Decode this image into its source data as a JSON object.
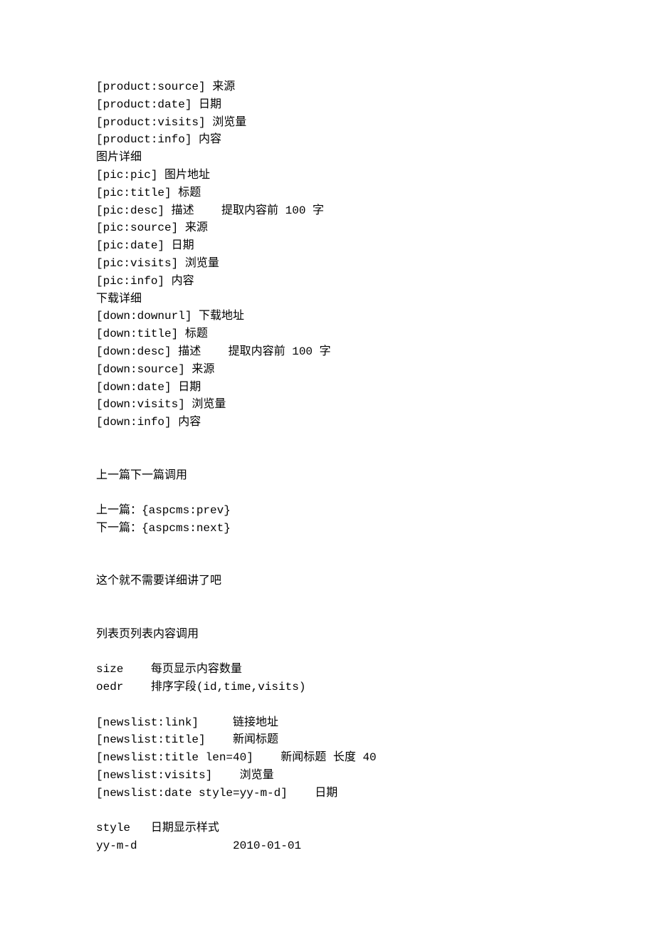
{
  "lines": [
    "[product:source] 来源",
    "[product:date] 日期",
    "[product:visits] 浏览量",
    "[product:info] 内容",
    "图片详细",
    "[pic:pic] 图片地址",
    "[pic:title] 标题",
    "[pic:desc] 描述    提取内容前 100 字",
    "[pic:source] 来源",
    "[pic:date] 日期",
    "[pic:visits] 浏览量",
    "[pic:info] 内容",
    "下载详细",
    "[down:downurl] 下载地址",
    "[down:title] 标题",
    "[down:desc] 描述    提取内容前 100 字",
    "[down:source] 来源",
    "[down:date] 日期",
    "[down:visits] 浏览量",
    "[down:info] 内容",
    "",
    "",
    "上一篇下一篇调用",
    "",
    "上一篇：{aspcms:prev}",
    "下一篇：{aspcms:next}",
    "",
    "",
    "这个就不需要详细讲了吧",
    "",
    "",
    "列表页列表内容调用",
    "",
    "size    每页显示内容数量",
    "oedr    排序字段(id,time,visits)",
    "",
    "[newslist:link]     链接地址",
    "[newslist:title]    新闻标题",
    "[newslist:title len=40]    新闻标题 长度 40",
    "[newslist:visits]    浏览量",
    "[newslist:date style=yy-m-d]    日期",
    "",
    "style   日期显示样式",
    "yy-m-d              2010-01-01"
  ]
}
